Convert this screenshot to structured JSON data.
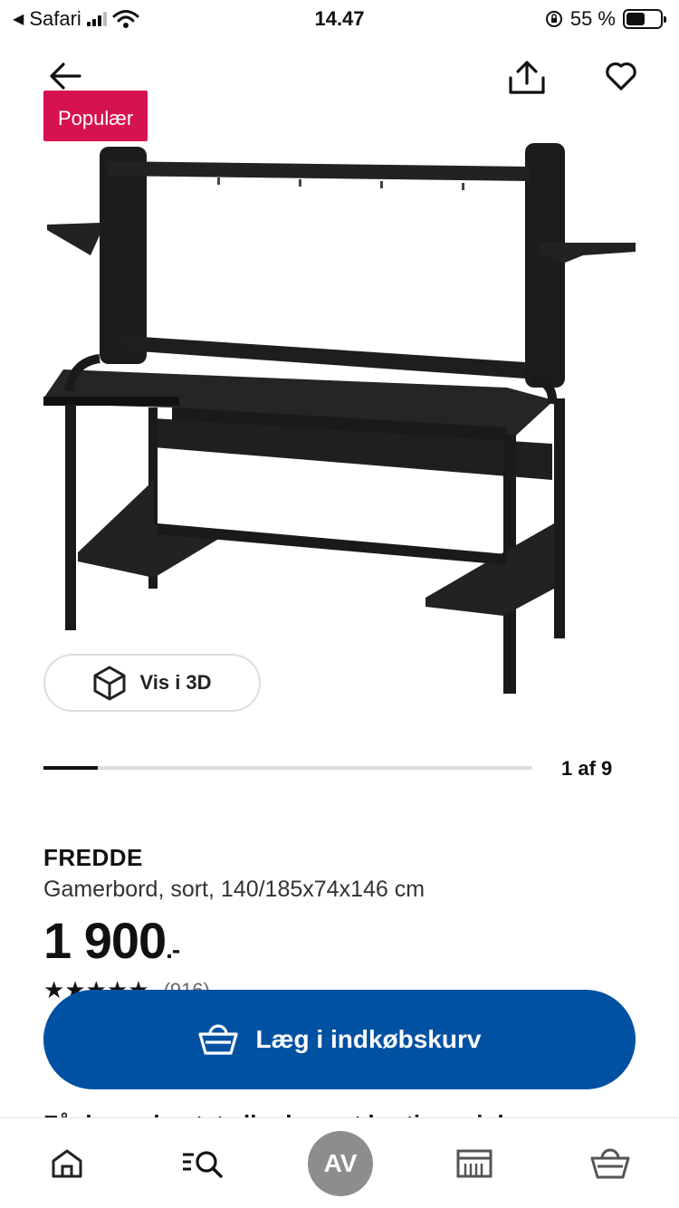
{
  "status_bar": {
    "back_app": "Safari",
    "time": "14.47",
    "battery_percent": "55 %",
    "battery_level": 0.55
  },
  "nav": {
    "back_icon": "arrow-left-icon",
    "share_icon": "share-icon",
    "favorite_icon": "heart-icon"
  },
  "badge": "Populær",
  "view_3d": {
    "label": "Vis i 3D",
    "icon": "cube-icon"
  },
  "pager": {
    "text": "1 af 9",
    "current": 1,
    "total": 9
  },
  "product": {
    "brand": "FREDDE",
    "description": "Gamerbord, sort, 140/185x74x146 cm",
    "price": "1 900",
    "price_suffix": ".-",
    "rating_stars": 4.5,
    "rating_count": "(916)"
  },
  "add_to_cart": {
    "label": "Læg i indkøbskurv",
    "icon": "basket-icon"
  },
  "below_fold_text": "Få denne hentet eller leveret hurtigere i dag",
  "tab_bar": {
    "home_icon": "home-icon",
    "search_icon": "search-list-icon",
    "profile_initials": "AV",
    "store_icon": "store-icon",
    "cart_icon": "basket-icon"
  },
  "colors": {
    "badge": "#d6124f",
    "primary_button": "#0151a3",
    "avatar": "#8d8d8d"
  }
}
